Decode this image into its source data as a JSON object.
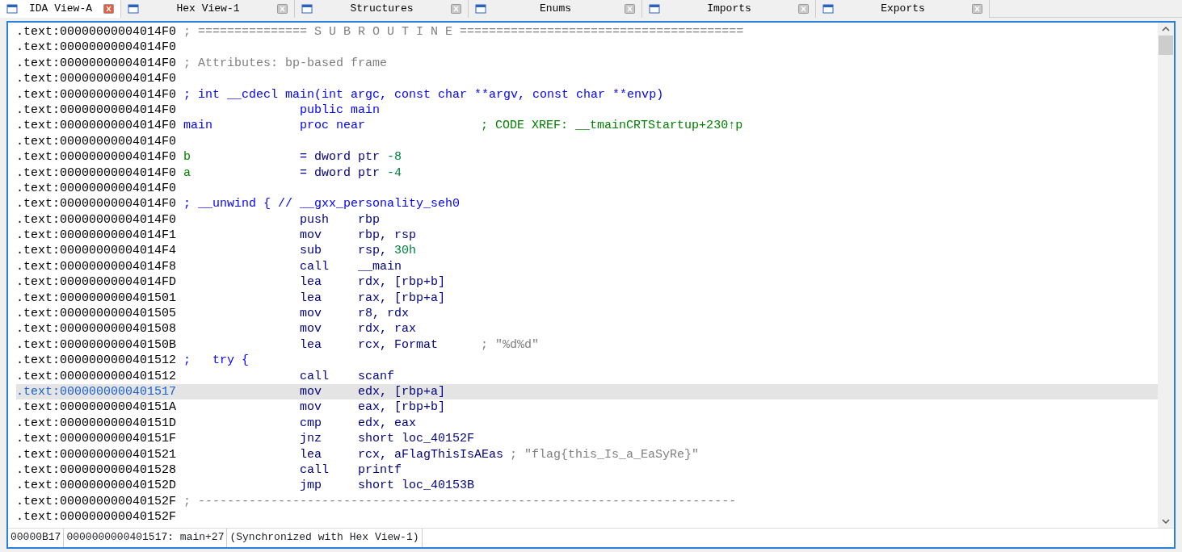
{
  "tabs": [
    {
      "label": "IDA View-A",
      "selected": true
    },
    {
      "label": "Hex View-1",
      "selected": false
    },
    {
      "label": "Structures",
      "selected": false
    },
    {
      "label": "Enums",
      "selected": false
    },
    {
      "label": "Imports",
      "selected": false
    },
    {
      "label": "Exports",
      "selected": false
    }
  ],
  "lines": [
    {
      "address": ".text:00000000004014F0",
      "selected": false,
      "comment": {
        "text": "; =============== S U B R O U T I N E =======================================",
        "kind": "auto"
      }
    },
    {
      "address": ".text:00000000004014F0",
      "selected": false
    },
    {
      "address": ".text:00000000004014F0",
      "selected": false,
      "comment": {
        "text": "; Attributes: bp-based frame",
        "kind": "auto"
      }
    },
    {
      "address": ".text:00000000004014F0",
      "selected": false
    },
    {
      "address": ".text:00000000004014F0",
      "selected": false,
      "comment": {
        "text": "; int __cdecl main(int argc, const char **argv, const char **envp)",
        "kind": "info"
      }
    },
    {
      "address": ".text:00000000004014F0",
      "selected": false,
      "operands": [
        {
          "text": "public main",
          "kind": "directive"
        }
      ]
    },
    {
      "address": ".text:00000000004014F0",
      "selected": false,
      "label": {
        "text": "main",
        "kind": "name"
      },
      "operands": [
        {
          "text": "proc near",
          "kind": "directive"
        }
      ],
      "comment": {
        "text": "; CODE XREF: __tmainCRTStartup+230↑p",
        "kind": "xref"
      }
    },
    {
      "address": ".text:00000000004014F0",
      "selected": false
    },
    {
      "address": ".text:00000000004014F0",
      "selected": false,
      "label": {
        "text": "b",
        "kind": "stackvar"
      },
      "operands": [
        {
          "text": "= dword ptr ",
          "kind": "plain"
        },
        {
          "text": "-8",
          "kind": "number"
        }
      ]
    },
    {
      "address": ".text:00000000004014F0",
      "selected": false,
      "label": {
        "text": "a",
        "kind": "stackvar"
      },
      "operands": [
        {
          "text": "= dword ptr ",
          "kind": "plain"
        },
        {
          "text": "-4",
          "kind": "number"
        }
      ]
    },
    {
      "address": ".text:00000000004014F0",
      "selected": false
    },
    {
      "address": ".text:00000000004014F0",
      "selected": false,
      "comment": {
        "text": "; __unwind { // __gxx_personality_seh0",
        "kind": "info"
      }
    },
    {
      "address": ".text:00000000004014F0",
      "selected": false,
      "mnemonic": "push",
      "operands": [
        {
          "text": "rbp",
          "kind": "plain"
        }
      ]
    },
    {
      "address": ".text:00000000004014F1",
      "selected": false,
      "mnemonic": "mov",
      "operands": [
        {
          "text": "rbp, rsp",
          "kind": "plain"
        }
      ]
    },
    {
      "address": ".text:00000000004014F4",
      "selected": false,
      "mnemonic": "sub",
      "operands": [
        {
          "text": "rsp, ",
          "kind": "plain"
        },
        {
          "text": "30h",
          "kind": "number"
        }
      ]
    },
    {
      "address": ".text:00000000004014F8",
      "selected": false,
      "mnemonic": "call",
      "operands": [
        {
          "text": "__main",
          "kind": "plain"
        }
      ]
    },
    {
      "address": ".text:00000000004014FD",
      "selected": false,
      "mnemonic": "lea",
      "operands": [
        {
          "text": "rdx, [rbp+b]",
          "kind": "plain"
        }
      ]
    },
    {
      "address": ".text:0000000000401501",
      "selected": false,
      "mnemonic": "lea",
      "operands": [
        {
          "text": "rax, [rbp+a]",
          "kind": "plain"
        }
      ]
    },
    {
      "address": ".text:0000000000401505",
      "selected": false,
      "mnemonic": "mov",
      "operands": [
        {
          "text": "r8, rdx",
          "kind": "plain"
        }
      ]
    },
    {
      "address": ".text:0000000000401508",
      "selected": false,
      "mnemonic": "mov",
      "operands": [
        {
          "text": "rdx, rax",
          "kind": "plain"
        }
      ]
    },
    {
      "address": ".text:000000000040150B",
      "selected": false,
      "mnemonic": "lea",
      "operands": [
        {
          "text": "rcx, Format",
          "kind": "plain"
        }
      ],
      "comment": {
        "text": "; \"%d%d\"",
        "kind": "auto"
      }
    },
    {
      "address": ".text:0000000000401512",
      "selected": false,
      "comment": {
        "text": ";   try {",
        "kind": "info"
      }
    },
    {
      "address": ".text:0000000000401512",
      "selected": false,
      "mnemonic": "call",
      "operands": [
        {
          "text": "scanf",
          "kind": "plain"
        }
      ]
    },
    {
      "address": ".text:0000000000401517",
      "selected": true,
      "mnemonic": "mov",
      "operands": [
        {
          "text": "edx, [rbp+a]",
          "kind": "plain"
        }
      ]
    },
    {
      "address": ".text:000000000040151A",
      "selected": false,
      "mnemonic": "mov",
      "operands": [
        {
          "text": "eax, [rbp+b]",
          "kind": "plain"
        }
      ]
    },
    {
      "address": ".text:000000000040151D",
      "selected": false,
      "mnemonic": "cmp",
      "operands": [
        {
          "text": "edx, eax",
          "kind": "plain"
        }
      ]
    },
    {
      "address": ".text:000000000040151F",
      "selected": false,
      "mnemonic": "jnz",
      "operands": [
        {
          "text": "short loc_40152F",
          "kind": "plain"
        }
      ]
    },
    {
      "address": ".text:0000000000401521",
      "selected": false,
      "mnemonic": "lea",
      "operands": [
        {
          "text": "rcx, aFlagThisIsAEas",
          "kind": "plain"
        }
      ],
      "comment": {
        "text": "; \"flag{this_Is_a_EaSyRe}\"",
        "kind": "auto"
      }
    },
    {
      "address": ".text:0000000000401528",
      "selected": false,
      "mnemonic": "call",
      "operands": [
        {
          "text": "printf",
          "kind": "plain"
        }
      ]
    },
    {
      "address": ".text:000000000040152D",
      "selected": false,
      "mnemonic": "jmp",
      "operands": [
        {
          "text": "short loc_40153B",
          "kind": "plain"
        }
      ]
    },
    {
      "address": ".text:000000000040152F",
      "selected": false,
      "comment": {
        "text": "; --------------------------------------------------------------------------",
        "kind": "auto"
      }
    },
    {
      "address": ".text:000000000040152F",
      "selected": false
    }
  ],
  "status_bar": [
    "00000B17",
    "0000000000401517: main+27",
    "(Synchronized with Hex View-1)"
  ]
}
